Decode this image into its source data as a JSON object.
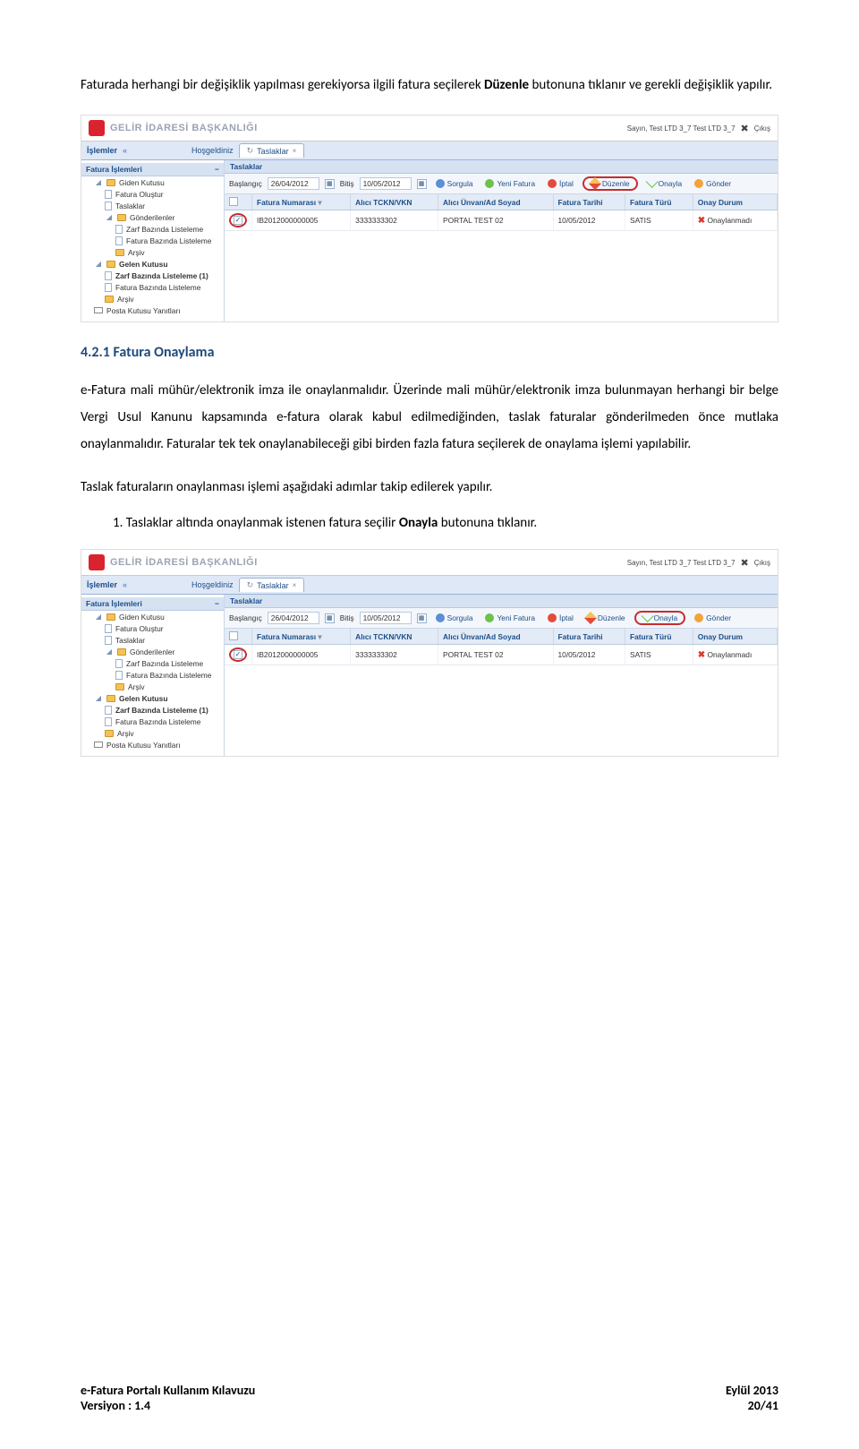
{
  "p1": {
    "pre": "Faturada herhangi bir değişiklik yapılması gerekiyorsa ilgili fatura seçilerek ",
    "bold": "Düzenle",
    "post": " butonuna tıklanır ve gerekli değişiklik yapılır."
  },
  "heading": "4.2.1 Fatura Onaylama",
  "p2": "e-Fatura mali mühür/elektronik imza ile onaylanmalıdır. Üzerinde mali mühür/elektronik imza bulunmayan herhangi bir belge Vergi Usul Kanunu kapsamında e-fatura olarak kabul edilmediğinden, taslak faturalar gönderilmeden önce mutlaka onaylanmalıdır. Faturalar tek tek onaylanabileceği gibi birden fazla fatura seçilerek de onaylama işlemi yapılabilir.",
  "p3": "Taslak faturaların onaylanması işlemi aşağıdaki adımlar takip edilerek yapılır.",
  "li1": {
    "num": "1.",
    "pre": " Taslaklar altında onaylanmak istenen fatura seçilir ",
    "bold": "Onayla",
    "post": " butonuna tıklanır."
  },
  "ss": {
    "brand": "GELİR İDARESİ BAŞKANLIĞI",
    "user": "Sayın, Test LTD 3_7 Test LTD 3_7",
    "exit": "Çıkış",
    "menubar_title": "İşlemler",
    "menubar_collapse": "«",
    "welcome": "Hoşgeldiniz",
    "tab_taslaklar": "Taslaklar",
    "tree_section": "Fatura İşlemleri",
    "tree_section_minus": "−",
    "tree": {
      "giden": "Giden Kutusu",
      "olustur": "Fatura Oluştur",
      "taslaklar": "Taslaklar",
      "gonderilenler": "Gönderilenler",
      "zarf_liste": "Zarf Bazında Listeleme",
      "fatura_liste": "Fatura Bazında Listeleme",
      "arsiv": "Arşiv",
      "gelen": "Gelen Kutusu",
      "zarf_liste1": "Zarf Bazında Listeleme (1)",
      "fatura_liste2": "Fatura Bazında Listeleme",
      "arsiv2": "Arşiv",
      "posta": "Posta Kutusu Yanıtları"
    },
    "main_header": "Taslaklar",
    "filter": {
      "baslangic_lbl": "Başlangıç",
      "baslangic": "26/04/2012",
      "bitis_lbl": "Bitiş",
      "bitis": "10/05/2012",
      "sorgula": "Sorgula",
      "yeni": "Yeni Fatura",
      "iptal": "İptal",
      "duzenle": "Düzenle",
      "onayla": "Onayla",
      "gonder": "Gönder"
    },
    "cols": {
      "c0": "",
      "c1": "Fatura Numarası",
      "c1s": "▾",
      "c2": "Alıcı TCKN/VKN",
      "c3": "Alıcı Ünvan/Ad Soyad",
      "c4": "Fatura Tarihi",
      "c5": "Fatura Türü",
      "c6": "Onay Durum"
    },
    "row": {
      "num": "IB2012000000005",
      "tckn": "3333333302",
      "unvan": "PORTAL TEST 02",
      "tarih": "10/05/2012",
      "tur": "SATIS",
      "onay": "Onaylanmadı"
    }
  },
  "footer": {
    "left1": "e-Fatura Portalı Kullanım Kılavuzu",
    "right1": "Eylül 2013",
    "left2": "Versiyon : 1.4",
    "right2": "20/41"
  }
}
